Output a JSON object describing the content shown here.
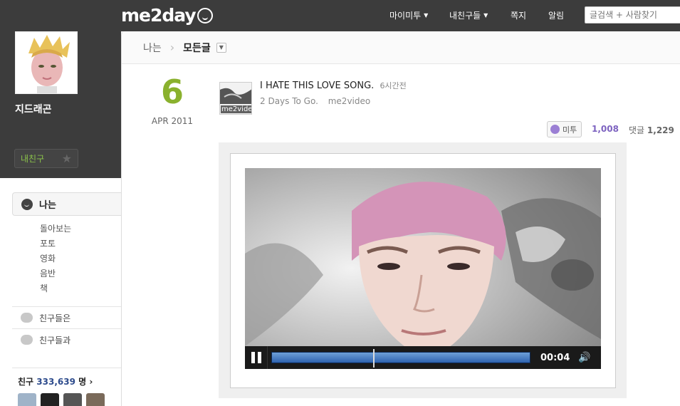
{
  "header": {
    "logo": "me2day",
    "nav": [
      "마이미투",
      "내친구들",
      "쪽지",
      "알림"
    ],
    "search_placeholder": "글검색 + 사람찾기"
  },
  "profile": {
    "name": "지드래곤",
    "friend_button": "내친구"
  },
  "sidebar": {
    "me_label": "나는",
    "sub_items": [
      "돌아보는",
      "포토",
      "영화",
      "음반",
      "책"
    ],
    "rows": [
      "친구들은",
      "친구들과"
    ],
    "friends_label": "친구",
    "friends_count": "333,639",
    "friends_unit": "명",
    "friends_arrow": "›"
  },
  "breadcrumb": {
    "root": "나는",
    "current": "모든글"
  },
  "post": {
    "day": "6",
    "month_year": "APR 2011",
    "thumb_label": "me2vide",
    "title": "I HATE THIS LOVE SONG.",
    "time_ago": "6시간전",
    "sub_text": "2 Days To Go.",
    "source": "me2video",
    "metoo_label": "미투",
    "metoo_count": "1,008",
    "comment_label": "댓글",
    "comment_count": "1,229"
  },
  "video": {
    "time": "00:04",
    "progress": 0.39
  },
  "colors": {
    "accent_green": "#8ab12e",
    "metoo_purple": "#7d63c0",
    "topbar": "#3c3c3c"
  }
}
